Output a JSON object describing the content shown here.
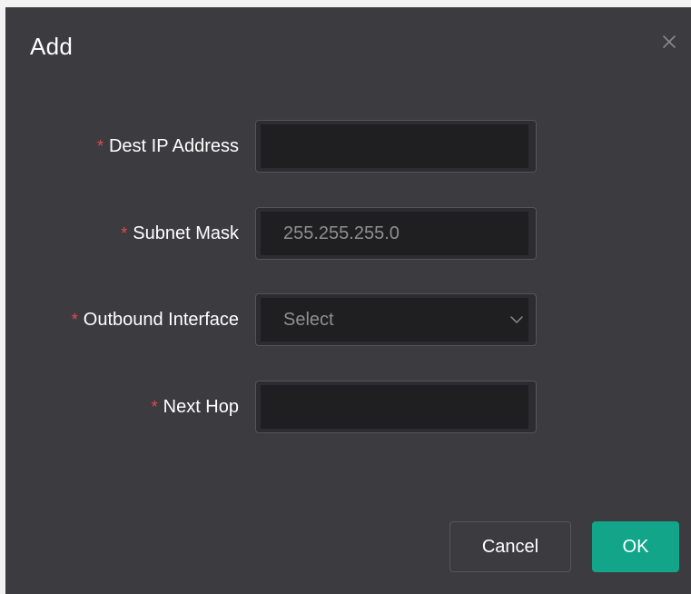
{
  "dialog": {
    "title": "Add",
    "close_icon": "close-icon"
  },
  "form": {
    "required_marker": "*",
    "dest_ip": {
      "label": "Dest IP Address",
      "value": "",
      "placeholder": ""
    },
    "subnet_mask": {
      "label": "Subnet Mask",
      "value": "",
      "placeholder": "255.255.255.0"
    },
    "outbound_interface": {
      "label": "Outbound Interface",
      "value": "",
      "placeholder": "Select"
    },
    "next_hop": {
      "label": "Next Hop",
      "value": "",
      "placeholder": ""
    }
  },
  "buttons": {
    "cancel_label": "Cancel",
    "ok_label": "OK"
  },
  "colors": {
    "dialog_bg": "#3c3b40",
    "input_bg": "#1f1f21",
    "required": "#e14c4c",
    "primary": "#13a58a"
  }
}
